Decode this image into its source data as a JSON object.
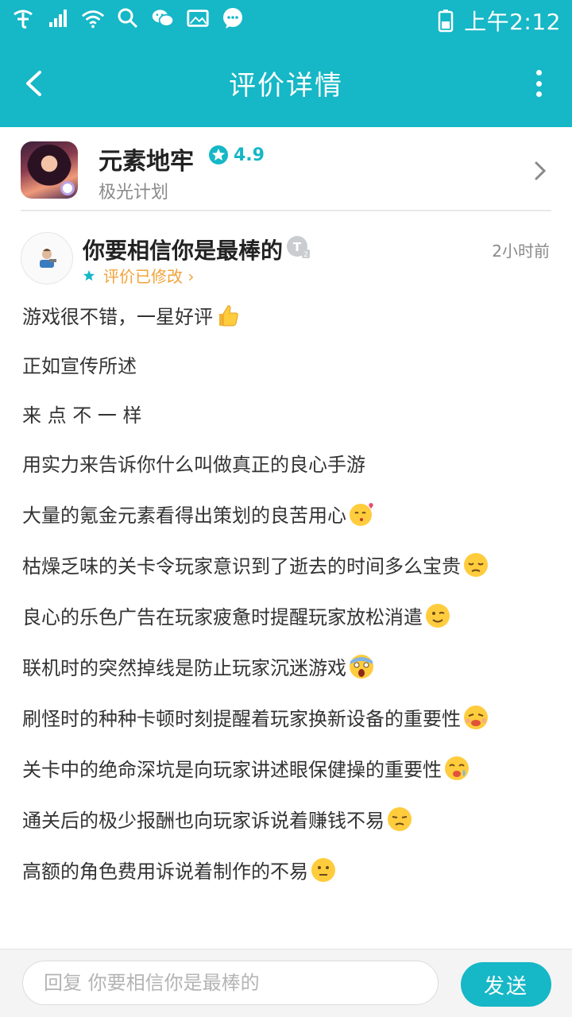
{
  "status_bar": {
    "time": "上午2:12",
    "icons": [
      "carrier-icon",
      "signal-icon",
      "wifi-icon",
      "search-icon",
      "wechat-icon",
      "gallery-icon",
      "message-icon",
      "battery-icon"
    ]
  },
  "app_bar": {
    "title": "评价详情",
    "back_icon": "back-arrow-icon",
    "more_icon": "more-vertical-icon"
  },
  "game": {
    "name": "元素地牢",
    "rating": "4.9",
    "developer": "极光计划"
  },
  "review": {
    "username": "你要相信你是最棒的",
    "level_badge": "T2",
    "time_ago": "2小时前",
    "edited_label": "评价已修改 ›",
    "lines": [
      {
        "text": "游戏很不错，一星好评",
        "emoji": "thumbs-up"
      },
      {
        "text": "正如宣传所述",
        "emoji": ""
      },
      {
        "text": "来 点 不 一 样",
        "emoji": ""
      },
      {
        "text": "用实力来告诉你什么叫做真正的良心手游",
        "emoji": ""
      },
      {
        "text": "大量的氪金元素看得出策划的良苦用心",
        "emoji": "kissing-heart"
      },
      {
        "text": "枯燥乏味的关卡令玩家意识到了逝去的时间多么宝贵",
        "emoji": "pensive"
      },
      {
        "text": "良心的乐色广告在玩家疲惫时提醒玩家放松消遣",
        "emoji": "winking"
      },
      {
        "text": "联机时的突然掉线是防止玩家沉迷游戏",
        "emoji": "screaming"
      },
      {
        "text": "刷怪时的种种卡顿时刻提醒着玩家换新设备的重要性",
        "emoji": "sweat"
      },
      {
        "text": "关卡中的绝命深坑是向玩家讲述眼保健操的重要性",
        "emoji": "crying"
      },
      {
        "text": "通关后的极少报酬也向玩家诉说着赚钱不易",
        "emoji": "unamused"
      },
      {
        "text": "高额的角色费用诉说着制作的不易",
        "emoji": "neutral"
      }
    ]
  },
  "reply": {
    "placeholder": "回复 你要相信你是最棒的",
    "send_label": "发送"
  },
  "colors": {
    "accent": "#16b7c6",
    "edited": "#f2a33a",
    "text": "#333333",
    "muted": "#8a8a8a"
  }
}
